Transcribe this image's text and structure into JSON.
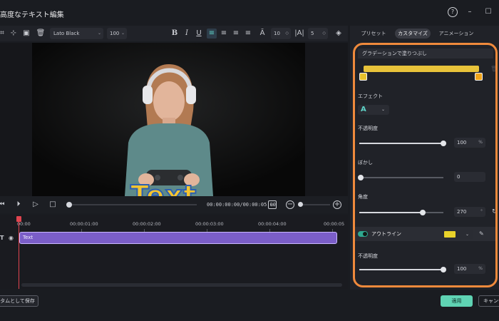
{
  "window": {
    "title": "高度なテキスト編集",
    "help_icon": "?",
    "minimize_icon": "–"
  },
  "toolbar": {
    "font": "Lato Black",
    "font_size": "100",
    "char_spacing": "10",
    "line_spacing": "5"
  },
  "player": {
    "overlay_text": "Text",
    "timecode": "00:00:00:00/00:00:05:00"
  },
  "timeline": {
    "ticks": [
      "00:00",
      "00:00:01:00",
      "00:00:02:00",
      "00:00:03:00",
      "00:00:04:00",
      "00:00:05"
    ],
    "clip_label": "Text"
  },
  "footer": {
    "save_label": "スタムとして保存",
    "apply_label": "適用",
    "cancel_label": "キャンセ"
  },
  "panel": {
    "tabs": [
      {
        "label": "プリセット",
        "active": false
      },
      {
        "label": "カスタマイズ",
        "active": true
      },
      {
        "label": "アニメーション",
        "active": false
      }
    ],
    "gradient_section": "グラデーションで塗りつぶし",
    "gradient_color": "#e8c33a",
    "stop_colors": [
      "#e6c12b",
      "#f0a51c"
    ],
    "effect_label": "エフェクト",
    "effect_value": "A",
    "opacity": {
      "label": "不透明度",
      "value": "100",
      "unit": "%"
    },
    "blur": {
      "label": "ぼかし",
      "value": "0"
    },
    "angle": {
      "label": "角度",
      "value": "270",
      "unit": "°"
    },
    "outline": {
      "label": "アウトライン",
      "enabled": true,
      "color": "#e9d22a"
    },
    "outline_opacity": {
      "label": "不透明度",
      "value": "100",
      "unit": "%"
    }
  },
  "highlight_color": "#f08a3c"
}
